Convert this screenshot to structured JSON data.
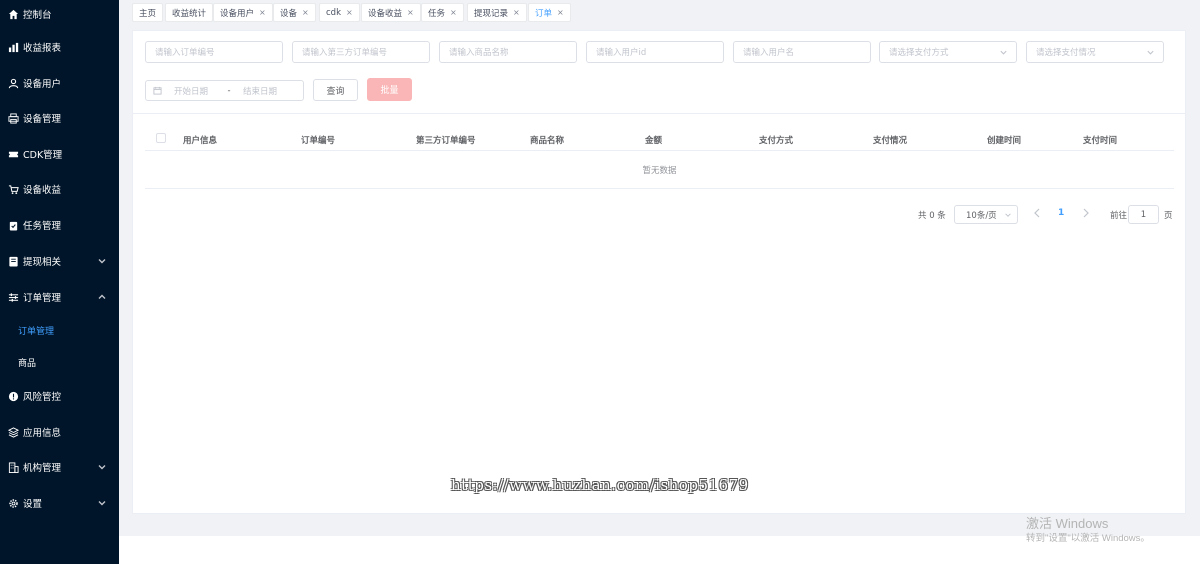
{
  "sidebar": {
    "items": [
      {
        "label": "控制台",
        "icon": "home-icon"
      },
      {
        "label": "收益报表",
        "icon": "bar-chart-icon"
      },
      {
        "label": "设备用户",
        "icon": "user-icon"
      },
      {
        "label": "设备管理",
        "icon": "printer-icon"
      },
      {
        "label": "CDK管理",
        "icon": "ticket-icon"
      },
      {
        "label": "设备收益",
        "icon": "cart-icon"
      },
      {
        "label": "任务管理",
        "icon": "clipboard-icon"
      },
      {
        "label": "提现相关",
        "icon": "wallet-icon",
        "expand": "down"
      },
      {
        "label": "订单管理",
        "icon": "sliders-icon",
        "expand": "up"
      },
      {
        "label": "风险管控",
        "icon": "alert-icon"
      },
      {
        "label": "应用信息",
        "icon": "app-icon"
      },
      {
        "label": "机构管理",
        "icon": "building-icon",
        "expand": "down"
      },
      {
        "label": "设置",
        "icon": "gear-icon",
        "expand": "down"
      }
    ],
    "sub_items": [
      {
        "label": "订单管理",
        "active": true
      },
      {
        "label": "商品",
        "active": false
      }
    ]
  },
  "tags": [
    {
      "label": "主页",
      "closable": false
    },
    {
      "label": "收益统计",
      "closable": false
    },
    {
      "label": "设备用户",
      "closable": true
    },
    {
      "label": "设备",
      "closable": true
    },
    {
      "label": "cdk",
      "closable": true
    },
    {
      "label": "设备收益",
      "closable": true
    },
    {
      "label": "任务",
      "closable": true
    },
    {
      "label": "提现记录",
      "closable": true
    },
    {
      "label": "订单",
      "closable": true,
      "active": true
    }
  ],
  "filters": {
    "order_no_placeholder": "请输入订单编号",
    "third_order_no_placeholder": "请输入第三方订单编号",
    "product_name_placeholder": "请输入商品名称",
    "user_id_placeholder": "请输入用户id",
    "username_placeholder": "请输入用户名",
    "pay_method_placeholder": "请选择支付方式",
    "pay_status_placeholder": "请选择支付情况",
    "start_date_placeholder": "开始日期",
    "date_separator": "-",
    "end_date_placeholder": "结束日期",
    "query_label": "查询",
    "batch_label": "批量"
  },
  "table": {
    "columns": [
      "用户信息",
      "订单编号",
      "第三方订单编号",
      "商品名称",
      "金额",
      "支付方式",
      "支付情况",
      "创建时间",
      "支付时间"
    ],
    "empty_text": "暂无数据"
  },
  "pagination": {
    "total_text": "共 0 条",
    "page_size": "10条/页",
    "current_page": "1",
    "goto_label": "前往",
    "goto_value": "1",
    "page_unit": "页"
  },
  "overlay": {
    "watermark": "https://www.huzhan.com/ishop51679",
    "activate_title": "激活 Windows",
    "activate_sub": "转到\"设置\"以激活 Windows。"
  },
  "colors": {
    "sidebar_bg": "#001529",
    "accent": "#409eff",
    "batch_button": "#fab6b6"
  }
}
